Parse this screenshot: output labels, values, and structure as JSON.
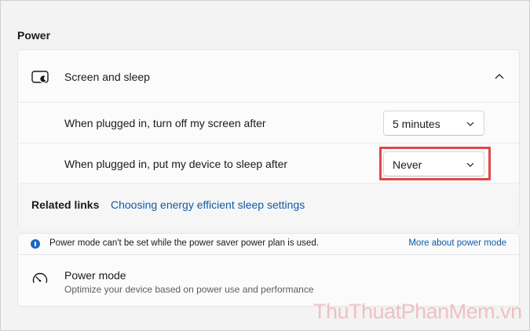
{
  "section": {
    "title": "Power"
  },
  "screen_sleep": {
    "header_label": "Screen and sleep",
    "screen_off_label": "When plugged in, turn off my screen after",
    "screen_off_value": "5 minutes",
    "sleep_label": "When plugged in, put my device to sleep after",
    "sleep_value": "Never",
    "related_label": "Related links",
    "related_link": "Choosing energy efficient sleep settings"
  },
  "power_mode": {
    "info_text": "Power mode can't be set while the power saver power plan is used.",
    "info_link": "More about power mode",
    "title": "Power mode",
    "description": "Optimize your device based on power use and performance"
  },
  "watermark": "ThuThuatPhanMem.vn",
  "colors": {
    "link": "#0f5aa6",
    "highlight": "#e04848",
    "info": "#1f66c2"
  },
  "icons": {
    "screen": "monitor-sleep-icon",
    "collapse": "chevron-up-icon",
    "dropdown": "chevron-down-icon",
    "info": "info-icon",
    "power_mode": "gauge-icon"
  }
}
